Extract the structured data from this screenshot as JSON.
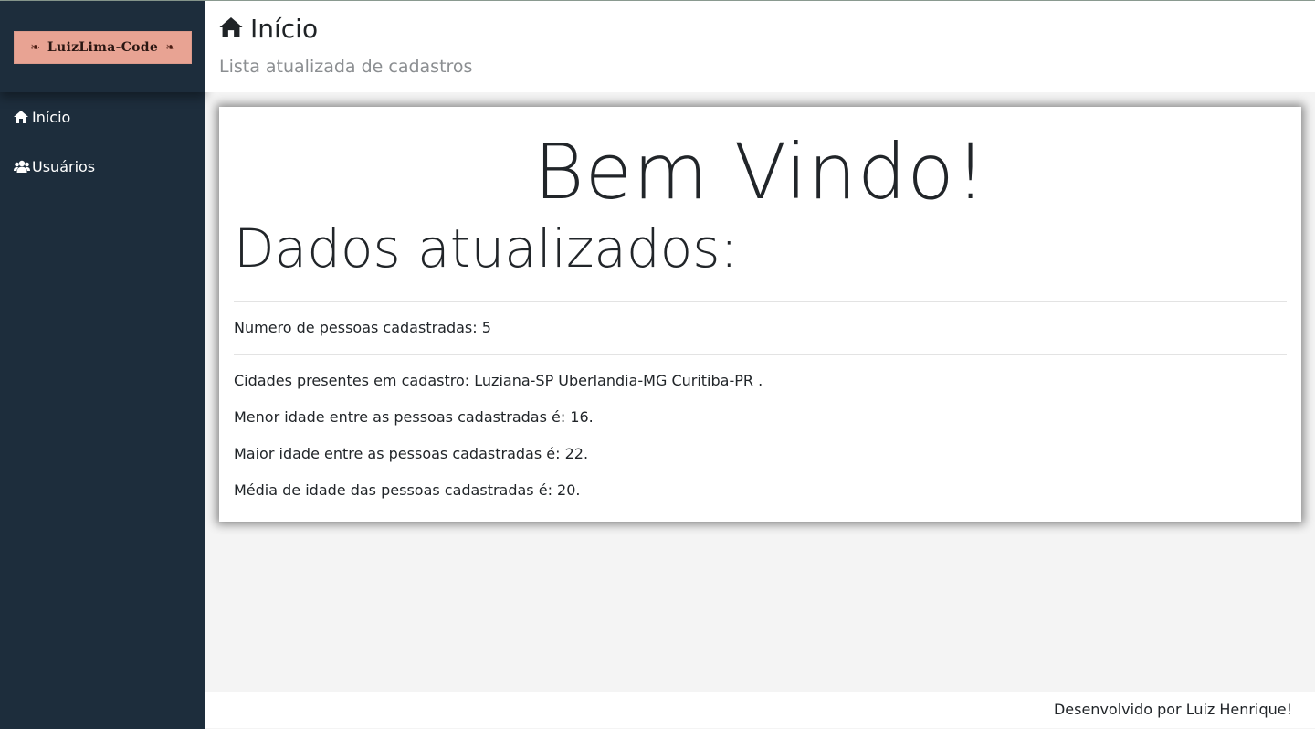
{
  "sidebar": {
    "logo_text": "LuizLima-Code",
    "items": [
      {
        "label": "Início",
        "icon": "home-icon"
      },
      {
        "label": "Usuários",
        "icon": "users-icon"
      }
    ]
  },
  "header": {
    "title": "Início",
    "subtitle": "Lista atualizada de cadastros"
  },
  "main": {
    "welcome": "Bem Vindo!",
    "section_title": "Dados atualizados:",
    "people_count": "Numero de pessoas cadastradas: 5",
    "cities": "Cidades presentes em cadastro: Luziana-SP Uberlandia-MG Curitiba-PR .",
    "min_age": "Menor idade entre as pessoas cadastradas é: 16.",
    "max_age": "Maior idade entre as pessoas cadastradas é: 22.",
    "avg_age": "Média de idade das pessoas cadastradas é: 20."
  },
  "footer": {
    "credit": "Desenvolvido por Luiz Henrique!"
  },
  "colors": {
    "sidebar_bg": "#1d2d3c",
    "logo_bg": "#e8a393",
    "content_bg": "#f4f4f4"
  }
}
